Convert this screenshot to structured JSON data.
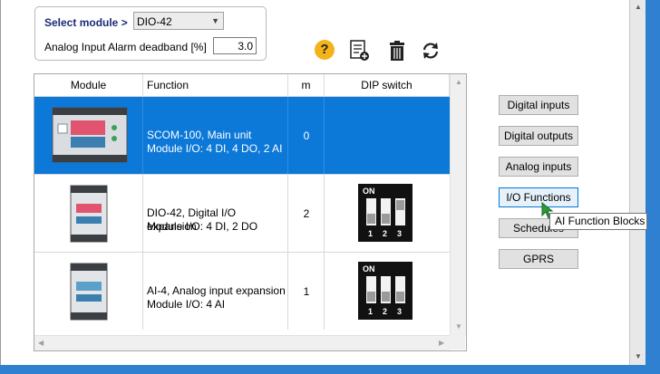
{
  "module_selector": {
    "label": "Select module >",
    "value": "DIO-42"
  },
  "deadband": {
    "label": "Analog Input Alarm deadband [%]",
    "value": "3.0"
  },
  "toolbar": {
    "help_glyph": "?"
  },
  "table": {
    "columns": [
      "Module",
      "Function",
      "m",
      "DIP switch"
    ],
    "rows": [
      {
        "function_line1": "SCOM-100, Main unit",
        "function_line2": "Module I/O: 4 DI, 4 DO, 2 AI",
        "m": "0",
        "selected": true
      },
      {
        "function_line1": "DIO-42, Digital I/O expansion",
        "function_line2": "Module I/O: 4 DI, 2 DO",
        "m": "2",
        "dip": {
          "on": "ON",
          "switches": [
            "1",
            "2",
            "3"
          ]
        }
      },
      {
        "function_line1": "AI-4, Analog input expansion",
        "function_line2": "Module I/O: 4 AI",
        "m": "1",
        "dip": {
          "on": "ON",
          "switches": [
            "1",
            "2",
            "3"
          ]
        }
      }
    ]
  },
  "side_buttons": {
    "digital_inputs": "Digital inputs",
    "digital_outputs": "Digital outputs",
    "analog_inputs": "Analog inputs",
    "io_functions": "I/O Functions",
    "schedules": "Schedules",
    "gprs": "GPRS"
  },
  "tooltip": "AI Function Blocks",
  "colors": {
    "selection": "#0c78d8",
    "accent_label": "#1a2a7a",
    "help_icon": "#f3b41b",
    "window_frame": "#2f80d0"
  }
}
